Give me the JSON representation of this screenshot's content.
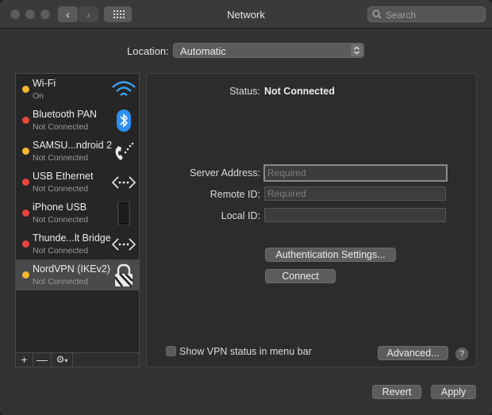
{
  "window": {
    "title": "Network"
  },
  "search": {
    "placeholder": "Search"
  },
  "location": {
    "label": "Location:",
    "value": "Automatic"
  },
  "services": [
    {
      "name": "Wi-Fi",
      "status": "On",
      "dot": "#f5b72c",
      "icon": "wifi-icon"
    },
    {
      "name": "Bluetooth PAN",
      "status": "Not Connected",
      "dot": "#e8453c",
      "icon": "bluetooth-icon"
    },
    {
      "name": "SAMSU...ndroid 2",
      "status": "Not Connected",
      "dot": "#f5b72c",
      "icon": "phone-icon"
    },
    {
      "name": "USB Ethernet",
      "status": "Not Connected",
      "dot": "#e8453c",
      "icon": "ethernet-icon"
    },
    {
      "name": "iPhone USB",
      "status": "Not Connected",
      "dot": "#e8453c",
      "icon": "iphone-icon"
    },
    {
      "name": "Thunde...lt Bridge",
      "status": "Not Connected",
      "dot": "#e8453c",
      "icon": "bridge-icon"
    },
    {
      "name": "NordVPN (IKEv2)",
      "status": "Not Connected",
      "dot": "#f5b72c",
      "icon": "vpn-lock-icon"
    }
  ],
  "sidebar_footer": {
    "add": "+",
    "remove": "—"
  },
  "detail": {
    "status_label": "Status:",
    "status_value": "Not Connected",
    "server_label": "Server Address:",
    "server_placeholder": "Required",
    "remote_label": "Remote ID:",
    "remote_placeholder": "Required",
    "local_label": "Local ID:",
    "auth_button": "Authentication Settings...",
    "connect_button": "Connect",
    "show_vpn_label": "Show VPN status in menu bar",
    "advanced_button": "Advanced...",
    "help": "?"
  },
  "footer": {
    "revert": "Revert",
    "apply": "Apply"
  },
  "colors": {
    "selected": "#4a4a4a",
    "accent_blue": "#2f8ff3",
    "wifi_blue": "#3ba0f5"
  }
}
